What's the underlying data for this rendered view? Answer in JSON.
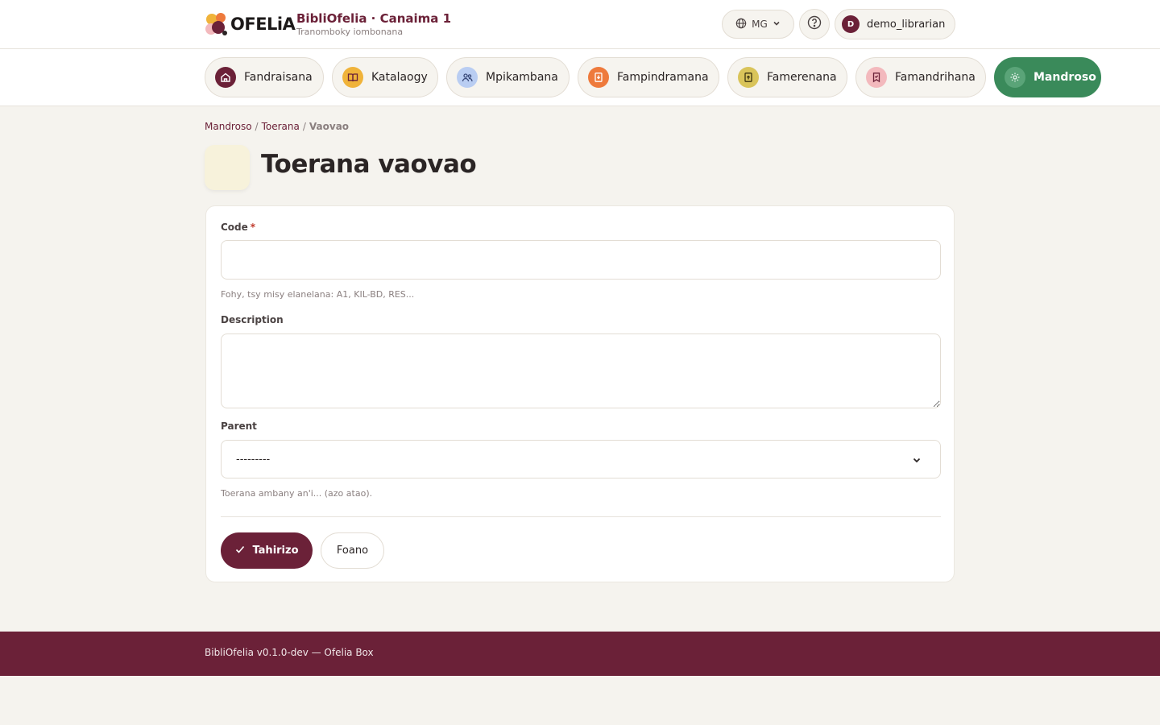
{
  "header": {
    "logo_text": "OFELiA",
    "brand_title": "BibliOfelia · Canaima 1",
    "brand_subtitle": "Tranomboky iombonana",
    "language": "MG",
    "user": {
      "initial": "D",
      "name": "demo_librarian"
    }
  },
  "nav": {
    "items": [
      {
        "label": "Fandraisana",
        "icon": "home-icon",
        "color": "#6b2138",
        "active": false
      },
      {
        "label": "Katalaogy",
        "icon": "book-icon",
        "color": "#f0b33a",
        "active": false
      },
      {
        "label": "Mpikambana",
        "icon": "users-icon",
        "color": "#b9cdf2",
        "active": false
      },
      {
        "label": "Fampindramana",
        "icon": "loan-icon",
        "color": "#ee7a3c",
        "active": false
      },
      {
        "label": "Famerenana",
        "icon": "return-icon",
        "color": "#d9c45a",
        "active": false
      },
      {
        "label": "Famandrihana",
        "icon": "bookmark-icon",
        "color": "#f3b9bd",
        "active": false
      },
      {
        "label": "Mandroso",
        "icon": "gear-icon",
        "color": "#5aa478",
        "active": true
      }
    ]
  },
  "breadcrumb": {
    "items": [
      "Mandroso",
      "Toerana"
    ],
    "current": "Vaovao"
  },
  "page": {
    "title": "Toerana vaovao"
  },
  "form": {
    "code": {
      "label": "Code",
      "required_mark": "*",
      "value": "",
      "help": "Fohy, tsy misy elanelana: A1, KIL-BD, RES..."
    },
    "description": {
      "label": "Description",
      "value": ""
    },
    "parent": {
      "label": "Parent",
      "selected": "---------",
      "help": "Toerana ambany an'i... (azo atao)."
    },
    "save_label": "Tahirizo",
    "cancel_label": "Foano"
  },
  "footer": {
    "text": "BibliOfelia v0.1.0-dev — Ofelia Box"
  }
}
